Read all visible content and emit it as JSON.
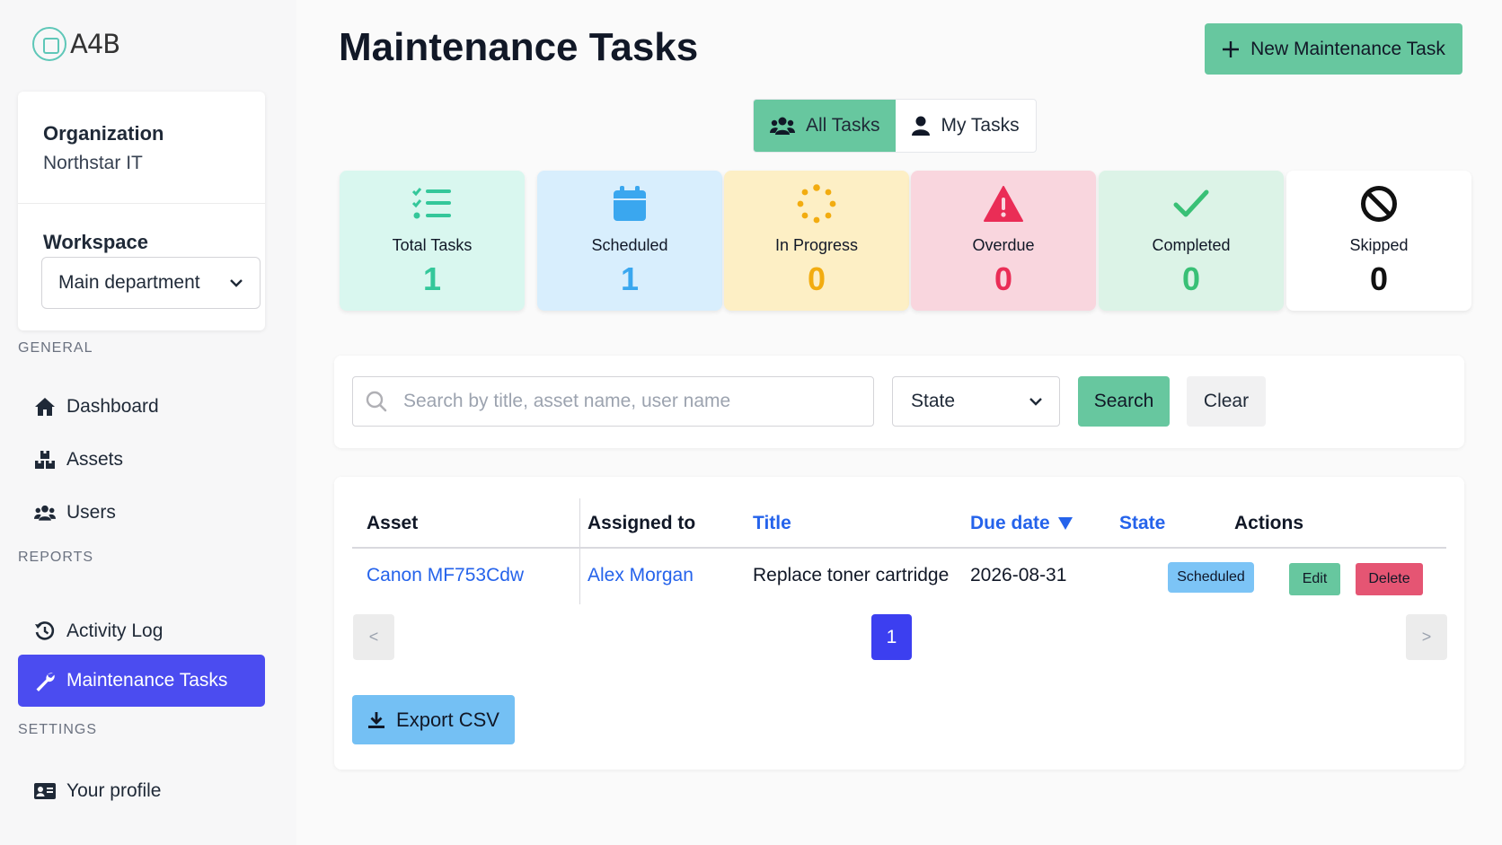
{
  "app": {
    "logo_text": "A4B"
  },
  "sidebar": {
    "organization_label": "Organization",
    "organization_value": "Northstar IT",
    "workspace_label": "Workspace",
    "workspace_value": "Main department",
    "sections": [
      {
        "label": "GENERAL",
        "items": [
          {
            "label": "Dashboard",
            "icon": "home-icon"
          },
          {
            "label": "Assets",
            "icon": "boxes-icon"
          },
          {
            "label": "Users",
            "icon": "users-icon"
          }
        ]
      },
      {
        "label": "REPORTS",
        "items": [
          {
            "label": "Activity Log",
            "icon": "history-icon"
          },
          {
            "label": "Maintenance Tasks",
            "icon": "wrench-icon",
            "active": true
          }
        ]
      },
      {
        "label": "SETTINGS",
        "items": [
          {
            "label": "Your profile",
            "icon": "id-card-icon"
          }
        ]
      }
    ]
  },
  "header": {
    "title": "Maintenance Tasks",
    "new_button_label": "New Maintenance Task"
  },
  "view_toggle": {
    "all_label": "All Tasks",
    "mine_label": "My Tasks",
    "active": "all"
  },
  "stats": [
    {
      "label": "Total Tasks",
      "value": "1",
      "icon": "list-check-icon",
      "bg": "#d9f7ef",
      "color": "#34c79a"
    },
    {
      "label": "Scheduled",
      "value": "1",
      "icon": "calendar-icon",
      "bg": "#d8eefd",
      "color": "#3aa7ef"
    },
    {
      "label": "In Progress",
      "value": "0",
      "icon": "spinner-icon",
      "bg": "#fdefc5",
      "color": "#f2ac10"
    },
    {
      "label": "Overdue",
      "value": "0",
      "icon": "warning-icon",
      "bg": "#f9d6de",
      "color": "#ea2d56"
    },
    {
      "label": "Completed",
      "value": "0",
      "icon": "check-icon",
      "bg": "#dcf3e7",
      "color": "#39c076"
    },
    {
      "label": "Skipped",
      "value": "0",
      "icon": "ban-icon",
      "bg": "#ffffff",
      "color": "#111111"
    }
  ],
  "filters": {
    "search_placeholder": "Search by title, asset name, user name",
    "search_value": "",
    "state_value": "State",
    "search_button": "Search",
    "clear_button": "Clear"
  },
  "table": {
    "headers": {
      "asset": "Asset",
      "assigned": "Assigned to",
      "title": "Title",
      "due": "Due date",
      "state": "State",
      "actions": "Actions"
    },
    "rows": [
      {
        "asset": "Canon MF753Cdw",
        "assigned": "Alex Morgan",
        "title": "Replace toner cartridge",
        "due": "2026-08-31",
        "state": "Scheduled",
        "edit": "Edit",
        "delete": "Delete"
      }
    ],
    "pagination": {
      "prev": "<",
      "page": "1",
      "next": ">"
    },
    "export_label": "Export CSV"
  },
  "colors": {
    "accent": "#67c79f",
    "primary": "#4b4cf0",
    "link": "#2563eb"
  }
}
